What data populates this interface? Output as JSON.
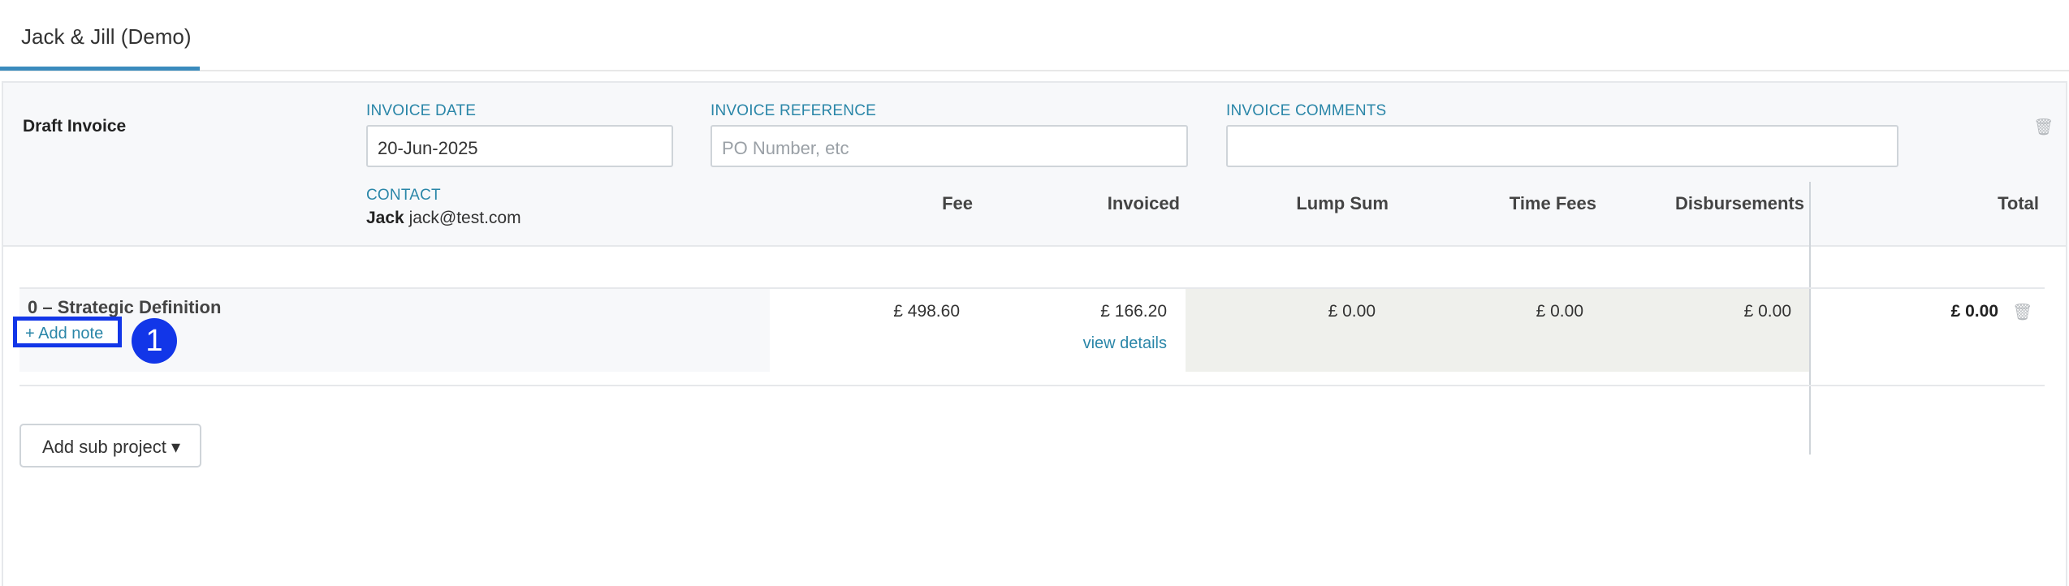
{
  "tab": {
    "label": "Jack & Jill (Demo)"
  },
  "invoice": {
    "title": "Draft Invoice",
    "date_label": "INVOICE DATE",
    "date_value": "20-Jun-2025",
    "reference_label": "INVOICE REFERENCE",
    "reference_placeholder": "PO Number, etc",
    "comments_label": "INVOICE COMMENTS",
    "comments_value": "",
    "contact_label": "CONTACT",
    "contact_name": "Jack",
    "contact_email": "jack@test.com"
  },
  "table": {
    "headers": [
      "Fee",
      "Invoiced",
      "Lump Sum",
      "Time Fees",
      "Disbursements",
      "Total"
    ],
    "rows": [
      {
        "title": "0 – Strategic Definition",
        "add_note": "+ Add note",
        "fee": "£ 498.60",
        "invoiced": "£ 166.20",
        "view_details": "view details",
        "lump_sum": "£ 0.00",
        "time_fees": "£ 0.00",
        "disbursements": "£ 0.00",
        "total": "£ 0.00"
      }
    ]
  },
  "annotation": {
    "badge_number": "1"
  },
  "actions": {
    "add_sub_project": "Add sub project ▾"
  },
  "icons": {
    "trash": "trash-icon"
  },
  "colors": {
    "accent": "#2a86a8",
    "tab_underline": "#3a8bbd",
    "highlight": "#1236e8"
  }
}
